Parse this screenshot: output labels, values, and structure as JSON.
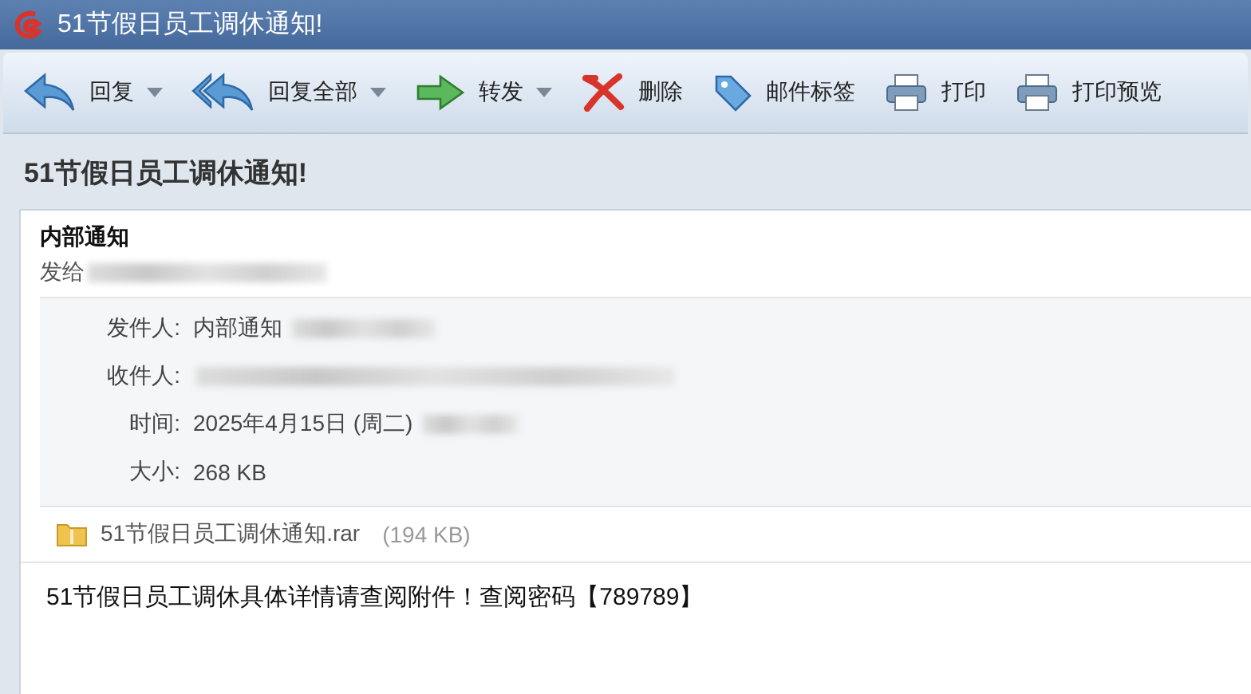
{
  "window": {
    "title": "51节假日员工调休通知!"
  },
  "toolbar": [
    {
      "kind": "reply",
      "label": "回复",
      "dropdown": true
    },
    {
      "kind": "reply-all",
      "label": "回复全部",
      "dropdown": true
    },
    {
      "kind": "forward",
      "label": "转发",
      "dropdown": true
    },
    {
      "kind": "delete",
      "label": "删除",
      "dropdown": false
    },
    {
      "kind": "tag",
      "label": "邮件标签",
      "dropdown": false
    },
    {
      "kind": "print",
      "label": "打印",
      "dropdown": false
    },
    {
      "kind": "print",
      "label": "打印预览",
      "dropdown": false
    }
  ],
  "subject": "51节假日员工调休通知!",
  "message": {
    "sender_name": "内部通知",
    "sent_to_label": "发给",
    "details": [
      {
        "label": "发件人:",
        "value": "内部通知",
        "redacted": true
      },
      {
        "label": "收件人:",
        "redacted": true
      },
      {
        "label": "时间:",
        "value": "2025年4月15日 (周二)",
        "redacted": true
      },
      {
        "label": "大小:",
        "value": "268 KB",
        "redacted": false
      }
    ],
    "attachment": {
      "name": "51节假日员工调休通知.rar",
      "size": "(194 KB)"
    },
    "body": "51节假日员工调休具体详情请查阅附件！查阅密码【789789】"
  }
}
